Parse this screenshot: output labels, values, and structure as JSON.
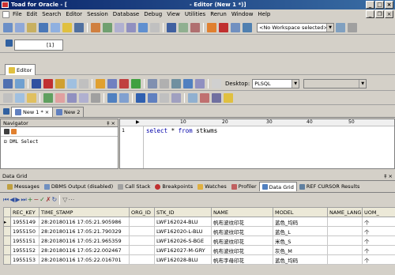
{
  "window": {
    "title": "Toad for Oracle - [",
    "title_suffix": "- Editor (New 1 *)]"
  },
  "menu": [
    "File",
    "Edit",
    "Search",
    "Editor",
    "Session",
    "Database",
    "Debug",
    "View",
    "Utilities",
    "Rerun",
    "Window",
    "Help"
  ],
  "workspace": {
    "selected": "<No Workspace selected>"
  },
  "connection_tab": {
    "label": "[1]"
  },
  "editor_tab": {
    "label": "Editor"
  },
  "desktop": {
    "label": "Desktop:",
    "value": "PLSQL"
  },
  "doc_tabs": [
    {
      "label": "New 1 *"
    },
    {
      "label": "New 2"
    }
  ],
  "navigator": {
    "title": "Navigator",
    "item": "DML Select"
  },
  "ruler": {
    "marks": [
      "10",
      "20",
      "30",
      "40",
      "50"
    ]
  },
  "editor": {
    "line_number": "1",
    "sql_keyword1": "select",
    "sql_star": "*",
    "sql_keyword2": "from",
    "sql_table": "stkwms"
  },
  "datagrid": {
    "title": "Data Grid",
    "tabs": [
      "Messages",
      "DBMS Output (disabled)",
      "Call Stack",
      "Breakpoints",
      "Watches",
      "Profiler",
      "Data Grid",
      "REF CURSOR Results"
    ],
    "columns": [
      "REC_KEY",
      "TIME_STAMP",
      "ORG_ID",
      "STK_ID",
      "NAME",
      "MODEL",
      "NAME_LANG",
      "UOM_"
    ],
    "rows": [
      [
        "1955149",
        "28:20180116 17:05:21.905986",
        "",
        "LWF162024-BLU",
        "帆布波纹印花",
        "蓝色_均码",
        "",
        "个"
      ],
      [
        "1955150",
        "28:20180116 17:05:21.790329",
        "",
        "LWF162020-L-BLU",
        "帆布波纹印花",
        "蓝色_L",
        "",
        "个"
      ],
      [
        "1955151",
        "28:20180116 17:05:21.965359",
        "",
        "LWF162026-S-BGE",
        "帆布波纹印花",
        "米色_S",
        "",
        "个"
      ],
      [
        "1955152",
        "28:20180116 17:05:22.002467",
        "",
        "LWF162027-M-GRY",
        "帆布波纹印花",
        "灰色_M",
        "",
        "个"
      ],
      [
        "1955153",
        "28:20180116 17:05:22.016701",
        "",
        "LWF162028-BLU",
        "帆布字母印花",
        "蓝色_均码",
        "",
        "个"
      ]
    ]
  }
}
